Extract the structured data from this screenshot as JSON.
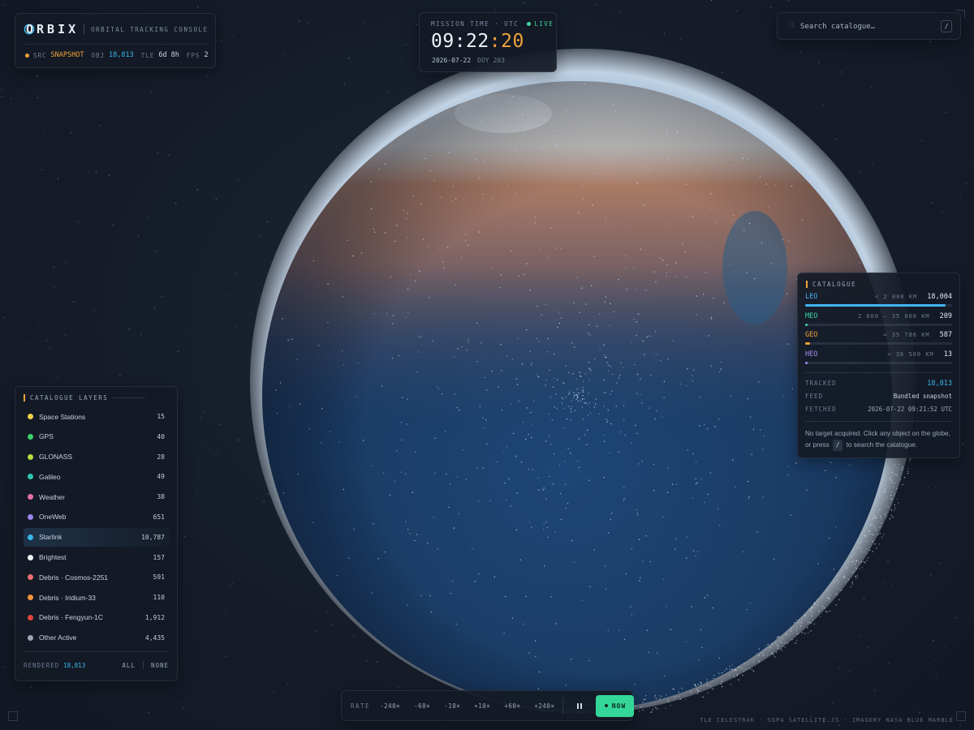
{
  "brand": {
    "logo": "ORBIX",
    "subtitle": "ORBITAL TRACKING CONSOLE",
    "stats": {
      "src_key": "SRC",
      "src_val": "SNAPSHOT",
      "obj_key": "OBJ",
      "obj_val": "18,813",
      "tle_key": "TLE",
      "tle_val": "6d 8h",
      "fps_key": "FPS",
      "fps_val": "2"
    }
  },
  "clock": {
    "label": "MISSION TIME · UTC",
    "live": "LIVE",
    "hhmm": "09:22",
    "seconds": ":20",
    "date": "2026-07-22",
    "doy": "DOY 203"
  },
  "search": {
    "placeholder": "Search catalogue…",
    "shortcut": "/"
  },
  "layers": {
    "title": "CATALOGUE LAYERS",
    "items": [
      {
        "name": "Space Stations",
        "count": "15",
        "color": "#f2d04a"
      },
      {
        "name": "GPS",
        "count": "40",
        "color": "#3fcf6b"
      },
      {
        "name": "GLONASS",
        "count": "28",
        "color": "#b6de3c"
      },
      {
        "name": "Galileo",
        "count": "49",
        "color": "#2ec8b3"
      },
      {
        "name": "Weather",
        "count": "38",
        "color": "#ea6fa8"
      },
      {
        "name": "OneWeb",
        "count": "651",
        "color": "#9b86ea"
      },
      {
        "name": "Starlink",
        "count": "10,787",
        "color": "#3ab6ee"
      },
      {
        "name": "Brightest",
        "count": "157",
        "color": "#f2f4f7"
      },
      {
        "name": "Debris · Cosmos-2251",
        "count": "591",
        "color": "#ee6f74"
      },
      {
        "name": "Debris · Iridium-33",
        "count": "110",
        "color": "#f2943c"
      },
      {
        "name": "Debris · Fengyun-1C",
        "count": "1,912",
        "color": "#e2443e"
      },
      {
        "name": "Other Active",
        "count": "4,435",
        "color": "#9ea6b2"
      }
    ],
    "active_index": 6,
    "footer": {
      "rendered_label": "RENDERED",
      "rendered_value": "18,813",
      "all": "ALL",
      "none": "NONE"
    }
  },
  "catalogue": {
    "title": "CATALOGUE",
    "orbits": [
      {
        "name": "LEO",
        "range": "< 2 000 KM",
        "count": "18,004",
        "color": "#44b4f2",
        "share": 0.957
      },
      {
        "name": "MEO",
        "range": "2 000 – 35 000 KM",
        "count": "209",
        "color": "#3fd6a0",
        "share": 0.011
      },
      {
        "name": "GEO",
        "range": "≈ 35 786 KM",
        "count": "587",
        "color": "#f0a33a",
        "share": 0.031
      },
      {
        "name": "HEO",
        "range": "> 36 500 KM",
        "count": "13",
        "color": "#a78bf0",
        "share": 0.001
      }
    ],
    "meta": {
      "tracked_label": "TRACKED",
      "tracked_value": "18,813",
      "feed_label": "FEED",
      "feed_value": "Bundled snapshot",
      "fetched_label": "FETCHED",
      "fetched_value": "2026-07-22 09:21:52 UTC"
    },
    "hint": {
      "line1": "No target acquired. Click any object on the globe,",
      "pre": "or press",
      "key": "/",
      "post": "to search the catalogue."
    }
  },
  "transport": {
    "rate_label": "RATE",
    "rates": [
      "-240×",
      "-60×",
      "-10×",
      "+10×",
      "+60×",
      "+240×"
    ],
    "now": "NOW"
  },
  "credits": "TLE CELESTRAK · SGP4 SATELLITE.JS · IMAGERY NASA BLUE MARBLE",
  "icons": {
    "search": "search-icon",
    "pause": "pause-icon",
    "logo_ring": "orbit-ring-icon"
  }
}
